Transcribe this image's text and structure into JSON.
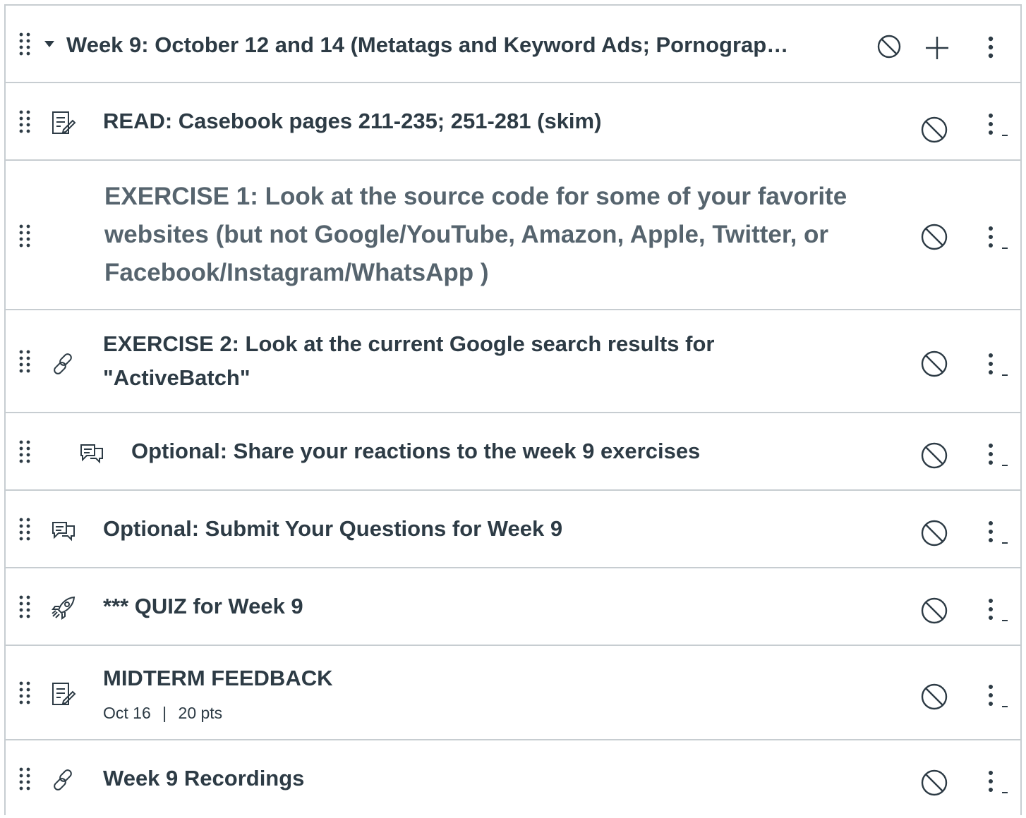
{
  "module": {
    "title": "Week 9: October 12 and 14 (Metatags and Keyword Ads; Pornograp…",
    "icons": [
      "drag-handle-icon",
      "caret-down-icon",
      "unpublished-icon",
      "plus-icon",
      "kebab-icon"
    ]
  },
  "items": [
    {
      "type": "assignment-icon",
      "title": "READ: Casebook pages 211-235; 251-281 (skim)"
    },
    {
      "type": "",
      "title": "EXERCISE 1: Look at the source code for some of your favorite websites (but not Google/YouTube, Amazon, Apple, Twitter, or Facebook/Instagram/WhatsApp )"
    },
    {
      "type": "link-icon",
      "title": "EXERCISE 2: Look at the current Google search results for \"ActiveBatch\""
    },
    {
      "type": "discussion-icon",
      "title": "Optional: Share your reactions to the week 9 exercises"
    },
    {
      "type": "discussion-icon",
      "title": "Optional: Submit Your Questions for Week 9"
    },
    {
      "type": "quiz-icon",
      "title": "*** QUIZ for Week 9"
    },
    {
      "type": "assignment-icon",
      "title": "MIDTERM FEEDBACK",
      "meta_date": "Oct 16",
      "meta_sep": "|",
      "meta_points": "20 pts"
    },
    {
      "type": "link-icon",
      "title": "Week 9 Recordings"
    }
  ],
  "colors": {
    "text": "#2d3b45",
    "muted": "#56646e",
    "border": "#c7cdd1"
  }
}
